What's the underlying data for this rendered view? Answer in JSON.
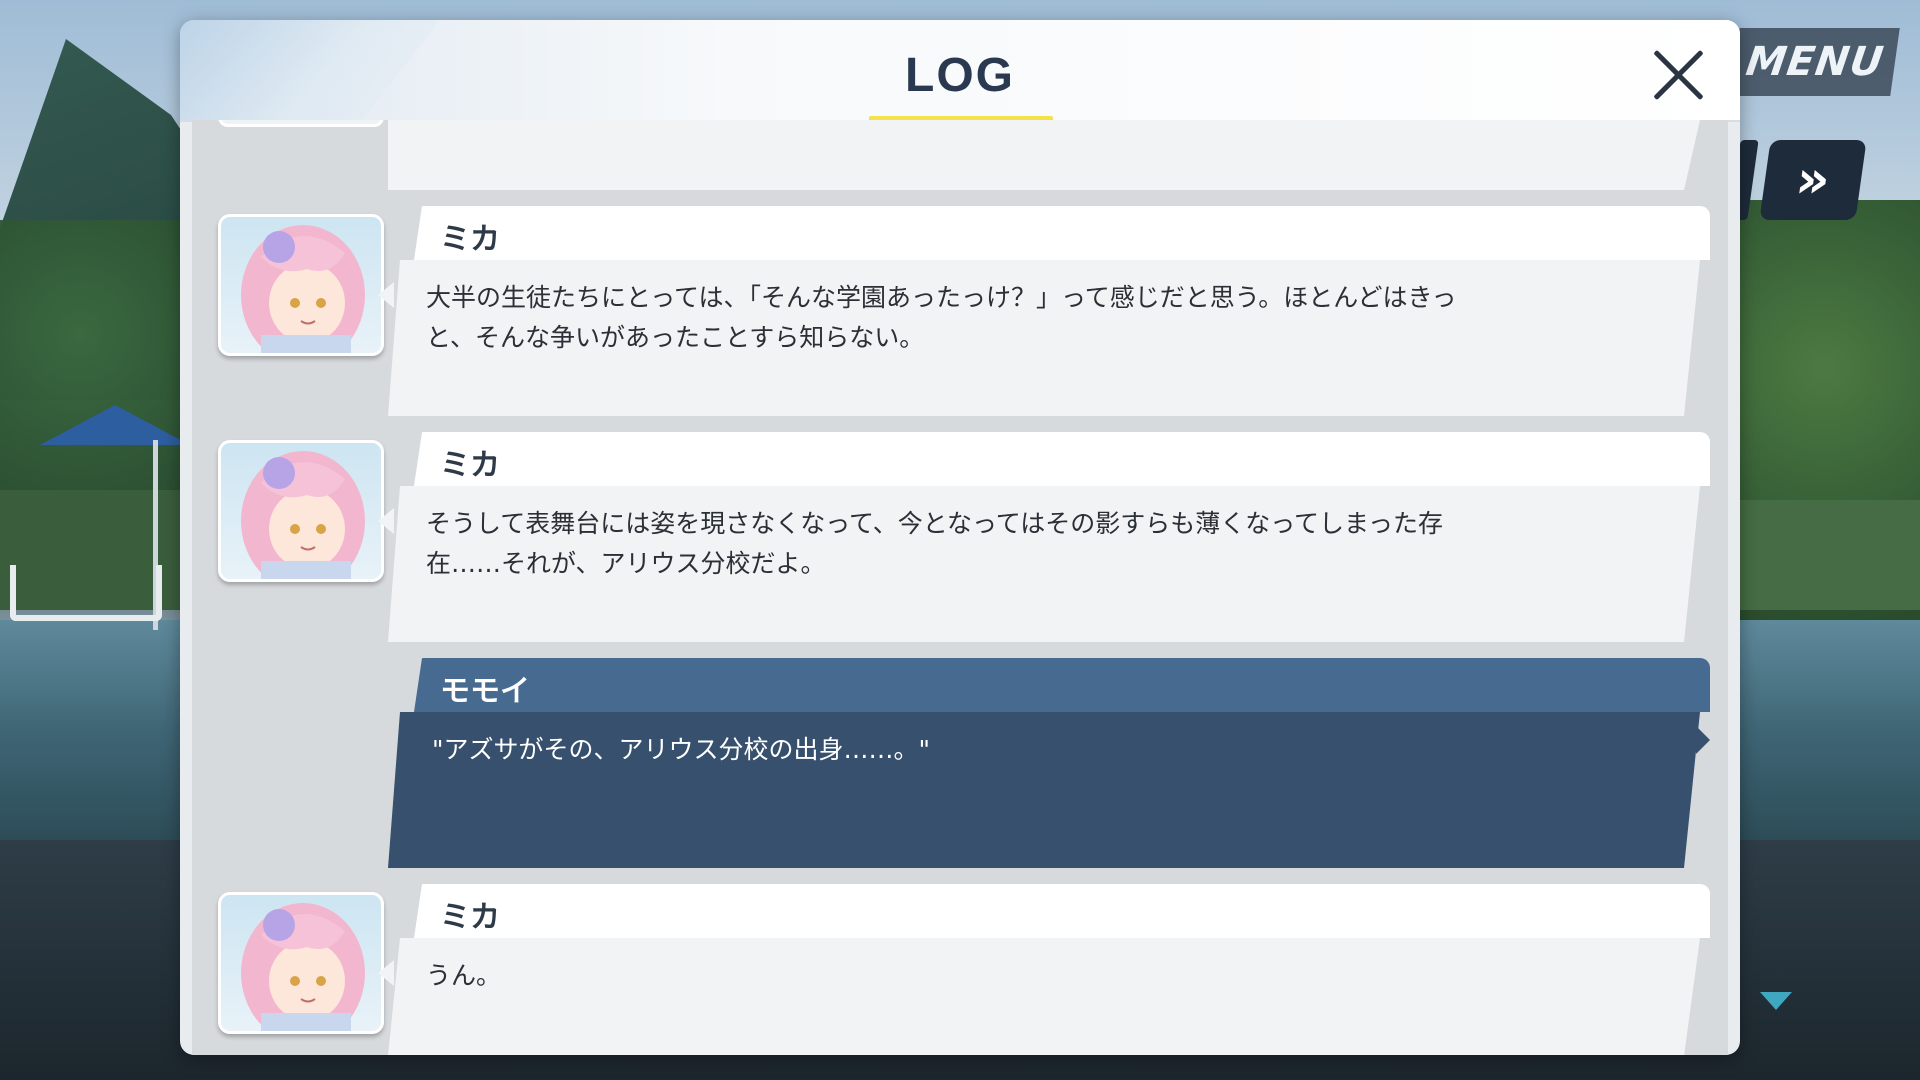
{
  "hud": {
    "menu_label": "MENU",
    "skip_label": "»"
  },
  "log": {
    "title": "LOG",
    "close_icon": "close-icon",
    "previous_fragment": "...",
    "entries": [
      {
        "speaker": "ミカ",
        "text": "大半の生徒たちにとっては、「そんな学園あったっけ？」って感じだと思う。ほとんどはきっ\nと、そんな争いがあったことすら知らない。",
        "avatar": "mika-portrait",
        "is_self": false
      },
      {
        "speaker": "ミカ",
        "text": "そうして表舞台には姿を現さなくなって、今となってはその影すらも薄くなってしまった存\n在……それが、アリウス分校だよ。",
        "avatar": "mika-portrait",
        "is_self": false
      },
      {
        "speaker": "モモイ",
        "text": "\"アズサがその、アリウス分校の出身……。\"",
        "is_self": true
      },
      {
        "speaker": "ミカ",
        "text": "うん。",
        "avatar": "mika-portrait",
        "is_self": false
      }
    ]
  },
  "colors": {
    "accent_underline": "#f4e24a",
    "self_name_bar": "#476a90",
    "self_bubble": "#36506e",
    "bubble": "#f2f3f5",
    "panel": "#e9ecef"
  }
}
